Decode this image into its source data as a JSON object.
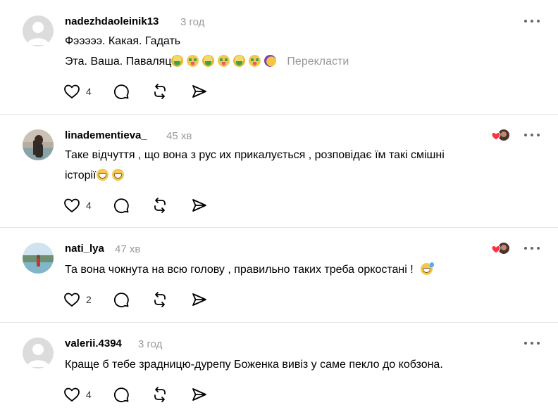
{
  "comments": [
    {
      "username": "nadezhdaoleinik13",
      "time": "3 год",
      "lines": [
        "Фэээээ. Какая. Гадать",
        "Эта. Ваша. Паваляц"
      ],
      "emojis": [
        "face-vomiting",
        "money-mouth-face",
        "face-vomiting",
        "money-mouth-face",
        "face-vomiting",
        "money-mouth-face",
        "rolling-on-floor-laughing"
      ],
      "translate_label": "Перекласти",
      "likes": "4",
      "liked_by_author": false
    },
    {
      "username": "linadementieva_",
      "time": "45 хв",
      "lines": [
        "Таке відчуття , що вона з рус их прикалується , розповідає їм такі смішні",
        "історії"
      ],
      "emojis": [
        "grinning-squinting-face",
        "grinning-squinting-face"
      ],
      "likes": "4",
      "liked_by_author": true
    },
    {
      "username": "nati_lya",
      "time": "47 хв",
      "lines": [
        "Та вона чокнута на всю голову , правильно таких треба оркостані !"
      ],
      "emojis": [
        "grinning-face-with-sweat"
      ],
      "likes": "2",
      "liked_by_author": true
    },
    {
      "username": "valerii.4394",
      "time": "3 год",
      "lines": [
        "Краще б тебе зрадницю-дурепу Боженка вивіз у саме пекло до кобзона."
      ],
      "likes": "4",
      "liked_by_author": false
    }
  ],
  "icons": {
    "like": "heart-outline-icon",
    "reply": "comment-bubble-icon",
    "repost": "repost-arrows-icon",
    "share": "send-arrow-icon",
    "more": "more-horizontal-icon",
    "liked_by_author": "author-liked-heart-icon"
  },
  "colors": {
    "muted": "#999999",
    "divider": "#e5e5e5",
    "heart": "#ff3040"
  }
}
